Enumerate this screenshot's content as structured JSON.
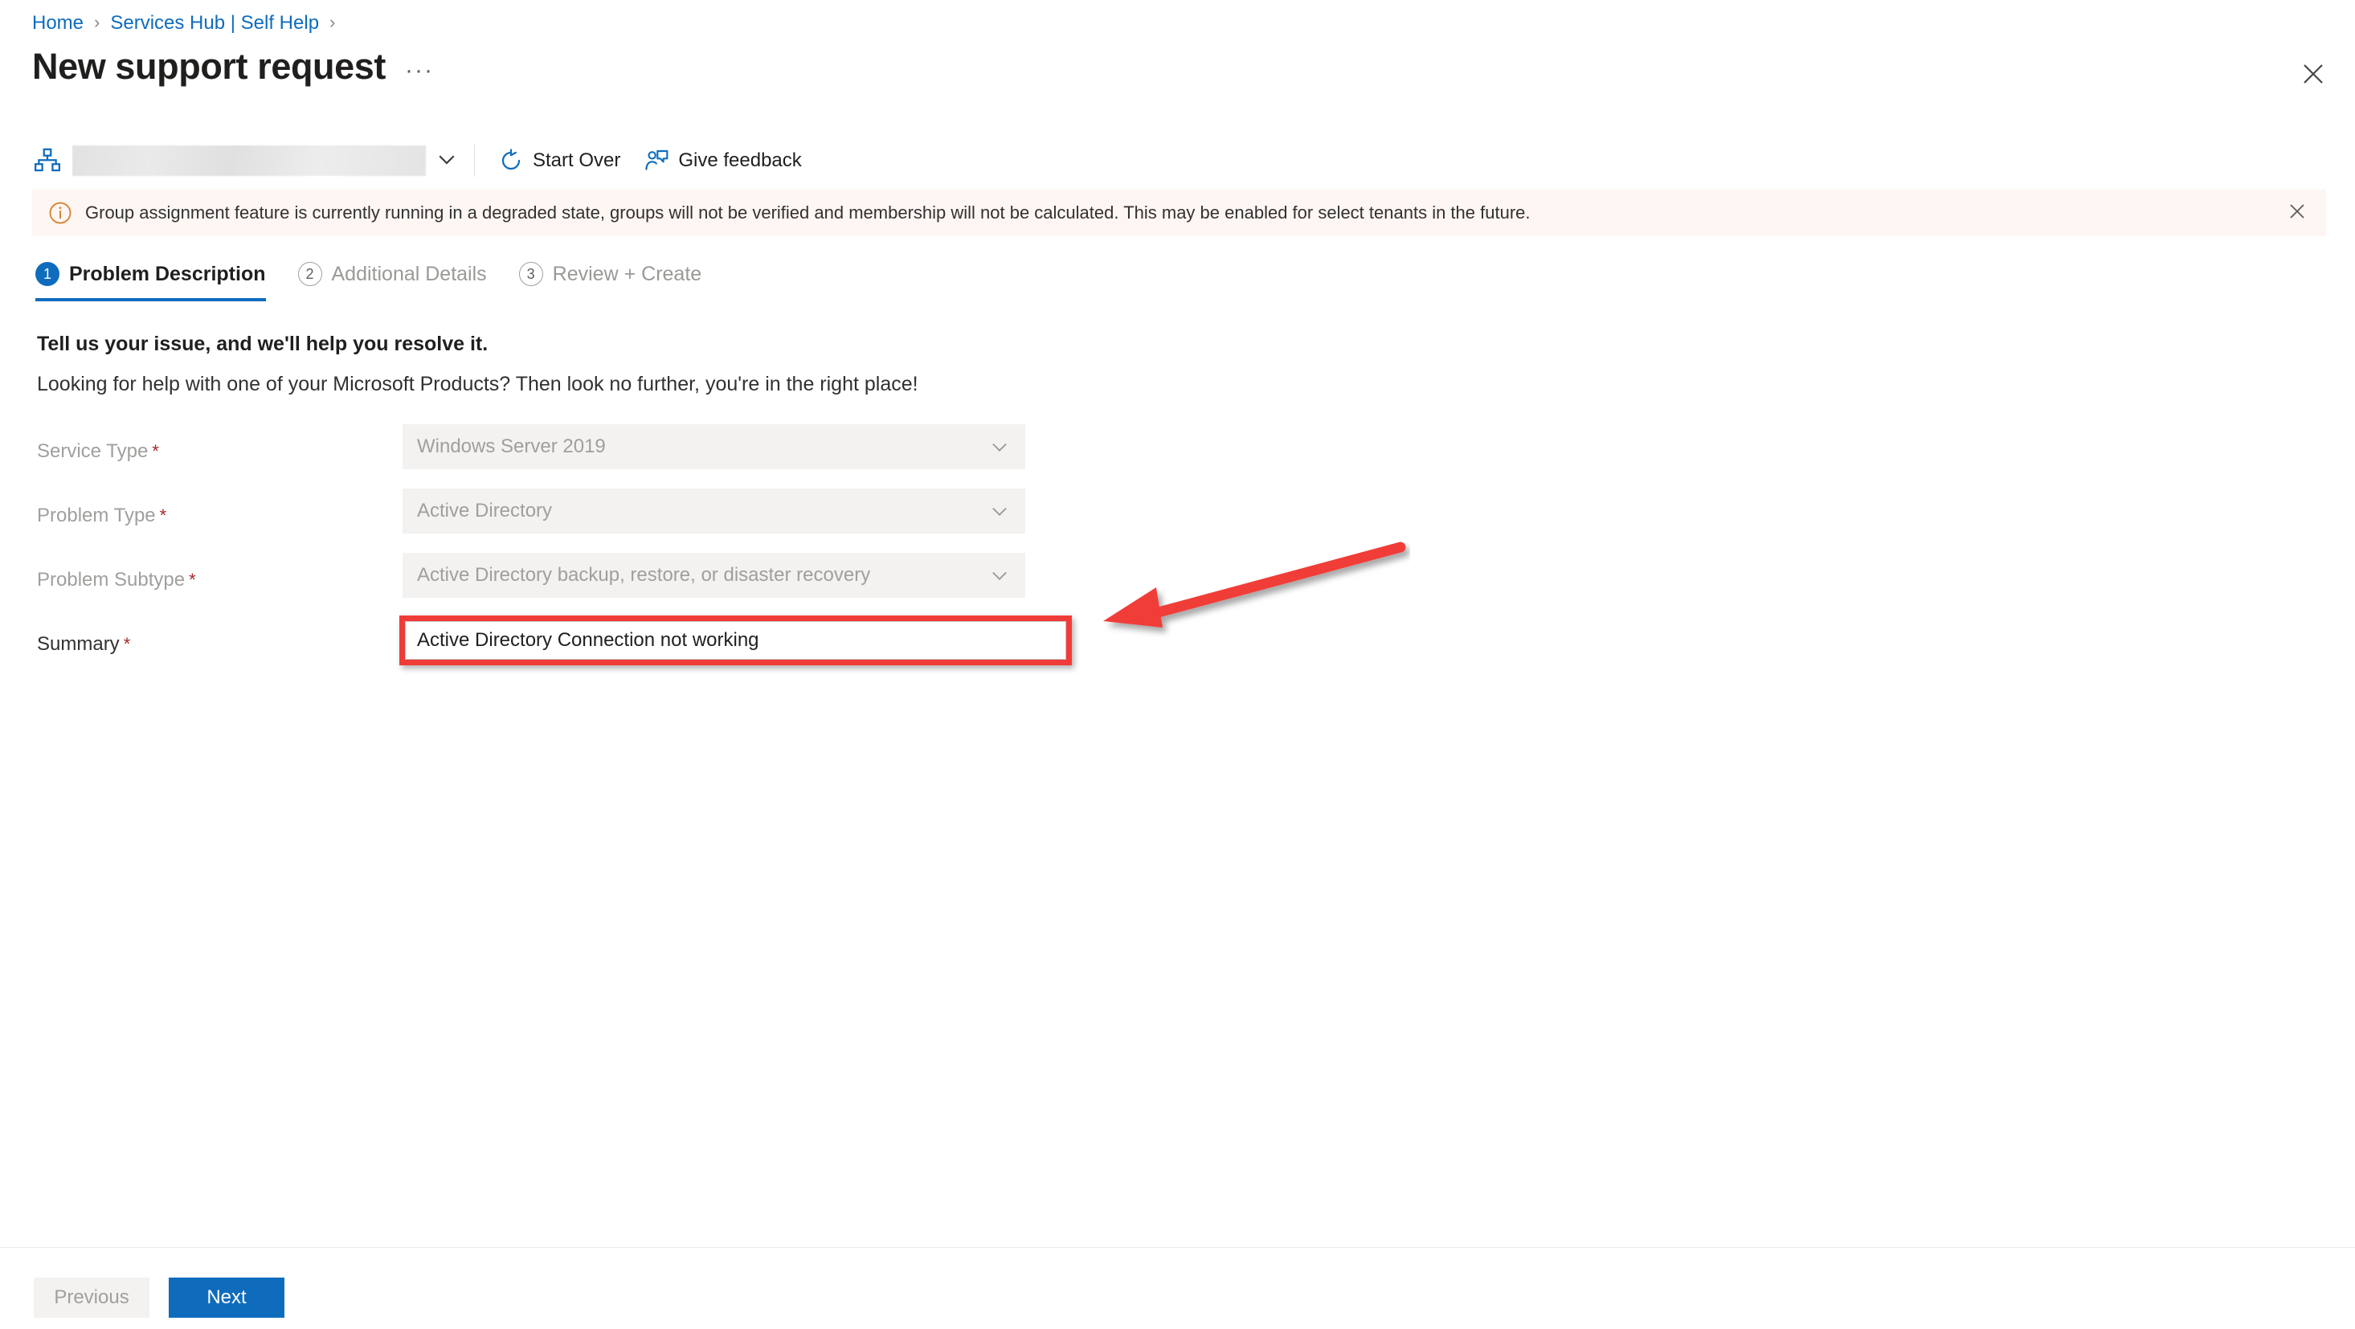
{
  "breadcrumb": {
    "items": [
      {
        "label": "Home"
      },
      {
        "label": "Services Hub | Self Help"
      }
    ],
    "separator": "›"
  },
  "header": {
    "title": "New support request",
    "overflow_label": "···",
    "close_icon": "close-icon"
  },
  "toolbar": {
    "org_icon": "org-hierarchy-icon",
    "org_select_value": "",
    "org_select_chevron": "chevron-down-icon",
    "actions": [
      {
        "label": "Start Over",
        "icon": "refresh-icon"
      },
      {
        "label": "Give feedback",
        "icon": "feedback-person-icon"
      }
    ]
  },
  "banner": {
    "icon": "info-circle-icon",
    "text": "Group assignment feature is currently running in a degraded state, groups will not be verified and membership will not be calculated. This may be enabled for select tenants in the future.",
    "close_icon": "close-icon",
    "background": "#fdf6f3",
    "icon_color": "#d88335"
  },
  "steps": [
    {
      "number": "1",
      "label": "Problem Description",
      "state": "active"
    },
    {
      "number": "2",
      "label": "Additional Details",
      "state": "inactive"
    },
    {
      "number": "3",
      "label": "Review + Create",
      "state": "inactive"
    }
  ],
  "content": {
    "heading": "Tell us your issue, and we'll help you resolve it.",
    "subheading": "Looking for help with one of your Microsoft Products? Then look no further, you're in the right place!"
  },
  "form": {
    "required_marker": "*",
    "fields": [
      {
        "label": "Service Type",
        "value": "Windows Server 2019",
        "control": "dropdown",
        "disabled": true,
        "chevron": "chevron-down-icon"
      },
      {
        "label": "Problem Type",
        "value": "Active Directory",
        "control": "dropdown",
        "disabled": true,
        "chevron": "chevron-down-icon"
      },
      {
        "label": "Problem Subtype",
        "value": "Active Directory backup, restore, or disaster recovery",
        "control": "dropdown",
        "disabled": true,
        "chevron": "chevron-down-icon"
      }
    ],
    "summary": {
      "label": "Summary",
      "value": "Active Directory Connection not working",
      "placeholder": "",
      "highlighted": true
    }
  },
  "annotation": {
    "arrow_color": "#f03c38",
    "highlight_color": "#f03c38",
    "points_to": "summary-input"
  },
  "footer": {
    "previous_label": "Previous",
    "next_label": "Next",
    "previous_disabled": true
  },
  "colors": {
    "accent": "#0f6cbd",
    "link": "#0f6cbd",
    "required": "#a4262c",
    "disabled_bg": "#f3f2f1",
    "disabled_text": "#a19f9d"
  }
}
